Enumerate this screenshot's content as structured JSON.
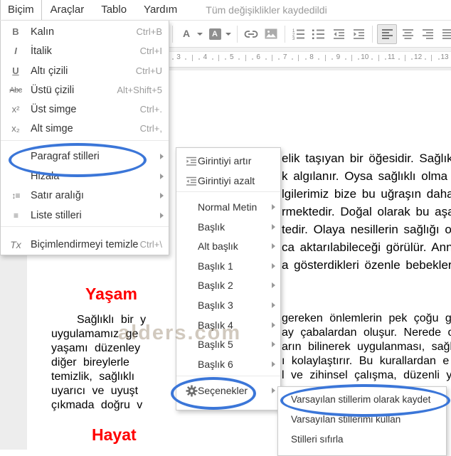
{
  "menubar": {
    "items": [
      {
        "label": "Biçim",
        "open": true
      },
      {
        "label": "Araçlar",
        "open": false
      },
      {
        "label": "Tablo",
        "open": false
      },
      {
        "label": "Yardım",
        "open": false
      }
    ],
    "status": "Tüm değişiklikler kaydedildi"
  },
  "toolbar": {
    "buttons": [
      "text-color",
      "highlight-color",
      "insert-link",
      "insert-image",
      "numbered-list",
      "bulleted-list",
      "indent-decrease",
      "indent-increase",
      "align-left",
      "align-center",
      "align-right",
      "align-justify",
      "line-spacing"
    ],
    "selected": "align-left",
    "text_color_letter": "A",
    "highlight_letter": "A",
    "accent_red": "#d93025"
  },
  "ruler": {
    "numbers": [
      3,
      4,
      5,
      6,
      7,
      8,
      9,
      10,
      11,
      12,
      13
    ]
  },
  "format_menu": {
    "items": [
      {
        "type": "item",
        "icon": "bold-icon",
        "glyph": "B",
        "label": "Kalın",
        "shortcut": "Ctrl+B"
      },
      {
        "type": "item",
        "icon": "italic-icon",
        "glyph": "I",
        "label": "İtalik",
        "shortcut": "Ctrl+I"
      },
      {
        "type": "item",
        "icon": "underline-icon",
        "glyph": "U",
        "label": "Altı çizili",
        "shortcut": "Ctrl+U"
      },
      {
        "type": "item",
        "icon": "strikethrough-icon",
        "glyph": "Abc",
        "label": "Üstü çizili",
        "shortcut": "Alt+Shift+5"
      },
      {
        "type": "item",
        "icon": "superscript-icon",
        "glyph": "x²",
        "label": "Üst simge",
        "shortcut": "Ctrl+."
      },
      {
        "type": "item",
        "icon": "subscript-icon",
        "glyph": "x₂",
        "label": "Alt simge",
        "shortcut": "Ctrl+,"
      },
      {
        "type": "separator"
      },
      {
        "type": "item",
        "label": "Paragraf stilleri",
        "submenu": true
      },
      {
        "type": "item",
        "label": "Hizala",
        "submenu": true
      },
      {
        "type": "item",
        "icon": "line-spacing-icon",
        "glyph": "↕≡",
        "label": "Satır aralığı",
        "submenu": true
      },
      {
        "type": "item",
        "icon": "list-styles-icon",
        "glyph": "≡",
        "label": "Liste stilleri",
        "submenu": true
      },
      {
        "type": "separator"
      },
      {
        "type": "item",
        "icon": "clear-formatting-icon",
        "glyph": "Tx",
        "label": "Biçimlendirmeyi temizle",
        "shortcut": "Ctrl+\\"
      }
    ]
  },
  "styles_submenu": {
    "items": [
      {
        "type": "item",
        "icon": "indent-increase-icon",
        "label": "Girintiyi artır"
      },
      {
        "type": "item",
        "icon": "indent-decrease-icon",
        "label": "Girintiyi azalt"
      },
      {
        "type": "separator"
      },
      {
        "type": "item",
        "label": "Normal Metin",
        "submenu": true
      },
      {
        "type": "item",
        "label": "Başlık",
        "submenu": true
      },
      {
        "type": "item",
        "label": "Alt başlık",
        "submenu": true
      },
      {
        "type": "item",
        "label": "Başlık 1",
        "submenu": true
      },
      {
        "type": "item",
        "label": "Başlık 2",
        "submenu": true
      },
      {
        "type": "item",
        "label": "Başlık 3",
        "submenu": true
      },
      {
        "type": "item",
        "label": "Başlık 4",
        "submenu": true
      },
      {
        "type": "item",
        "label": "Başlık 5",
        "submenu": true
      },
      {
        "type": "item",
        "label": "Başlık 6",
        "submenu": true
      },
      {
        "type": "separator"
      },
      {
        "type": "item",
        "icon": "gear-icon",
        "label": "Seçenekler",
        "submenu": true
      }
    ]
  },
  "options_submenu": {
    "items": [
      {
        "label": "Varsayılan stillerim olarak kaydet"
      },
      {
        "label": "Varsayılan stillerimi kullan"
      },
      {
        "label": "Stilleri sıfırla"
      }
    ]
  },
  "document": {
    "headings": [
      "Yaşam",
      "Hayat"
    ],
    "heading_color": "#ff0000",
    "paragraph1_fragments": [
      "elik taşıyan bir öğesidir. Sağlık gene",
      "k algılanır. Oysa sağlıklı olma uğrund",
      "lgilerimiz bize bu uğraşın daha doğ",
      "rmektedir. Doğal olarak bu aşamac",
      "tedir. Olaya nesillerin sağlığı olarak",
      "ca aktarılabileceği görülür. Anne ve",
      "a gösterdikleri özenle bebeklerine s"
    ],
    "paragraph2_left_fragments": [
      "Sağlıklı bir y",
      "uygulamamız ge",
      "yaşamı düzenley",
      "diğer bireylerle",
      "temizlik, sağlıklı",
      "uyarıcı ve uyuşt",
      "çıkmada doğru v"
    ],
    "paragraph2_right_fragments": [
      "gereken önlemlerin pek çoğu gün",
      "ay çabalardan oluşur. Nerede olu",
      "arın bilinerek uygulanması, sağlığı",
      "ı kolaylaştırır. Bu kurallardan e",
      "l ve zihinsel çalışma, düzenli yaşa"
    ],
    "watermark": "alders.com"
  },
  "annotations": {
    "ellipse_color": "#3b76d8"
  }
}
